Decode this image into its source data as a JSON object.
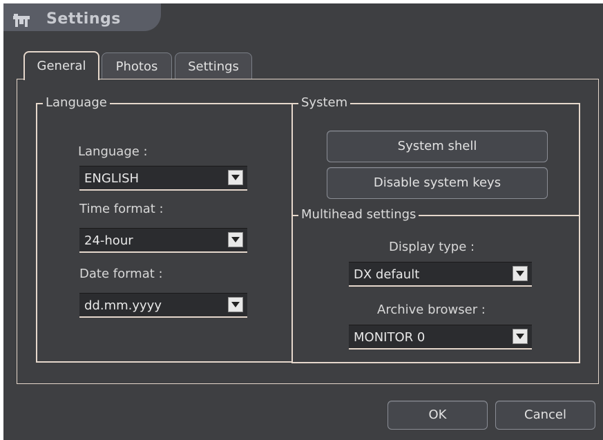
{
  "window": {
    "title": "Settings",
    "title_icon": "settings-app-icon"
  },
  "tabs": [
    {
      "label": "General",
      "active": true
    },
    {
      "label": "Photos",
      "active": false
    },
    {
      "label": "Settings",
      "active": false
    }
  ],
  "language_group": {
    "legend": "Language",
    "language_label": "Language :",
    "language_value": "ENGLISH",
    "time_format_label": "Time format :",
    "time_format_value": "24-hour",
    "date_format_label": "Date format :",
    "date_format_value": "dd.mm.yyyy"
  },
  "system_group": {
    "legend": "System",
    "system_shell_label": "System shell",
    "disable_keys_label": "Disable system keys"
  },
  "multihead_group": {
    "legend": "Multihead settings",
    "display_type_label": "Display type :",
    "display_type_value": "DX default",
    "archive_browser_label": "Archive browser :",
    "archive_browser_value": "MONITOR 0"
  },
  "footer": {
    "ok_label": "OK",
    "cancel_label": "Cancel"
  },
  "colors": {
    "background": "#3e3f42",
    "border": "#e6d8cc",
    "title_tab": "#5a5d66"
  }
}
